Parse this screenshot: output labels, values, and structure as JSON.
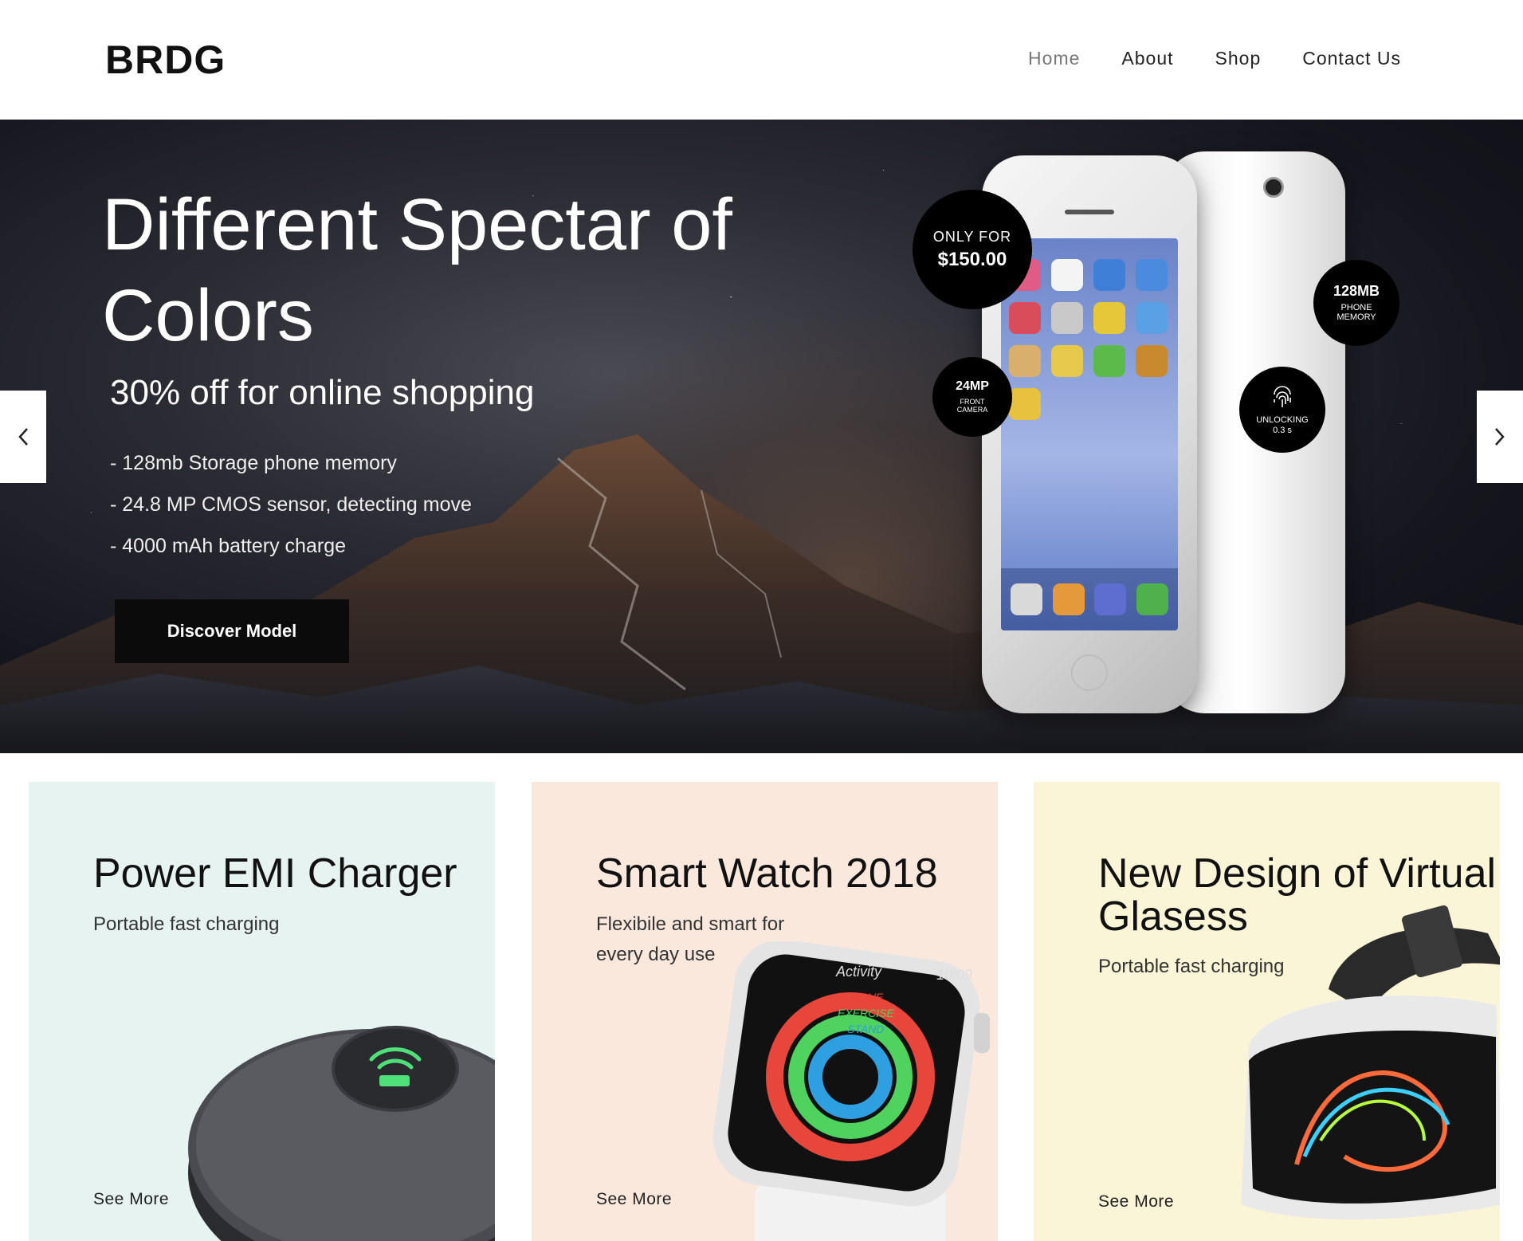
{
  "brand": {
    "logo": "BRDG"
  },
  "nav": {
    "items": [
      {
        "label": "Home",
        "active": true
      },
      {
        "label": "About"
      },
      {
        "label": "Shop"
      },
      {
        "label": "Contact Us"
      }
    ]
  },
  "hero": {
    "title": "Different Spectar of Colors",
    "subtitle": "30% off for online shopping",
    "features": [
      "- 128mb Storage phone memory",
      "- 24.8 MP CMOS sensor, detecting move",
      " - 4000 mAh battery charge"
    ],
    "cta_label": "Discover Model",
    "badges": {
      "price_label": "ONLY FOR",
      "price_value": "$150.00",
      "memory_value": "128MB",
      "memory_label_1": "PHONE",
      "memory_label_2": "MEMORY",
      "camera_value": "24MP",
      "camera_label_1": "FRONT",
      "camera_label_2": "CAMERA",
      "unlock_label": "UNLOCKING",
      "unlock_value": "0.3 s"
    },
    "prev_icon": "chevron-left-icon",
    "next_icon": "chevron-right-icon"
  },
  "cards": [
    {
      "title": "Power EMI Charger",
      "desc": "Portable fast charging",
      "link": "See More",
      "bg": "#e7f3f1"
    },
    {
      "title": "Smart Watch 2018",
      "desc": "Flexibile and smart for every day use",
      "link": "See More",
      "bg": "#fbe8dd"
    },
    {
      "title": "New Design of Virtual Glasess",
      "desc": "Portable fast charging",
      "link": "See More",
      "bg": "#fbf5d8"
    }
  ],
  "watch": {
    "app_title": "Activity",
    "time": "10:09",
    "rings": [
      "MOVE",
      "EXERCISE",
      "STAND"
    ]
  },
  "colors": {
    "accent": "#0b0b0b",
    "nav_active": "#777777",
    "text": "#111111"
  }
}
